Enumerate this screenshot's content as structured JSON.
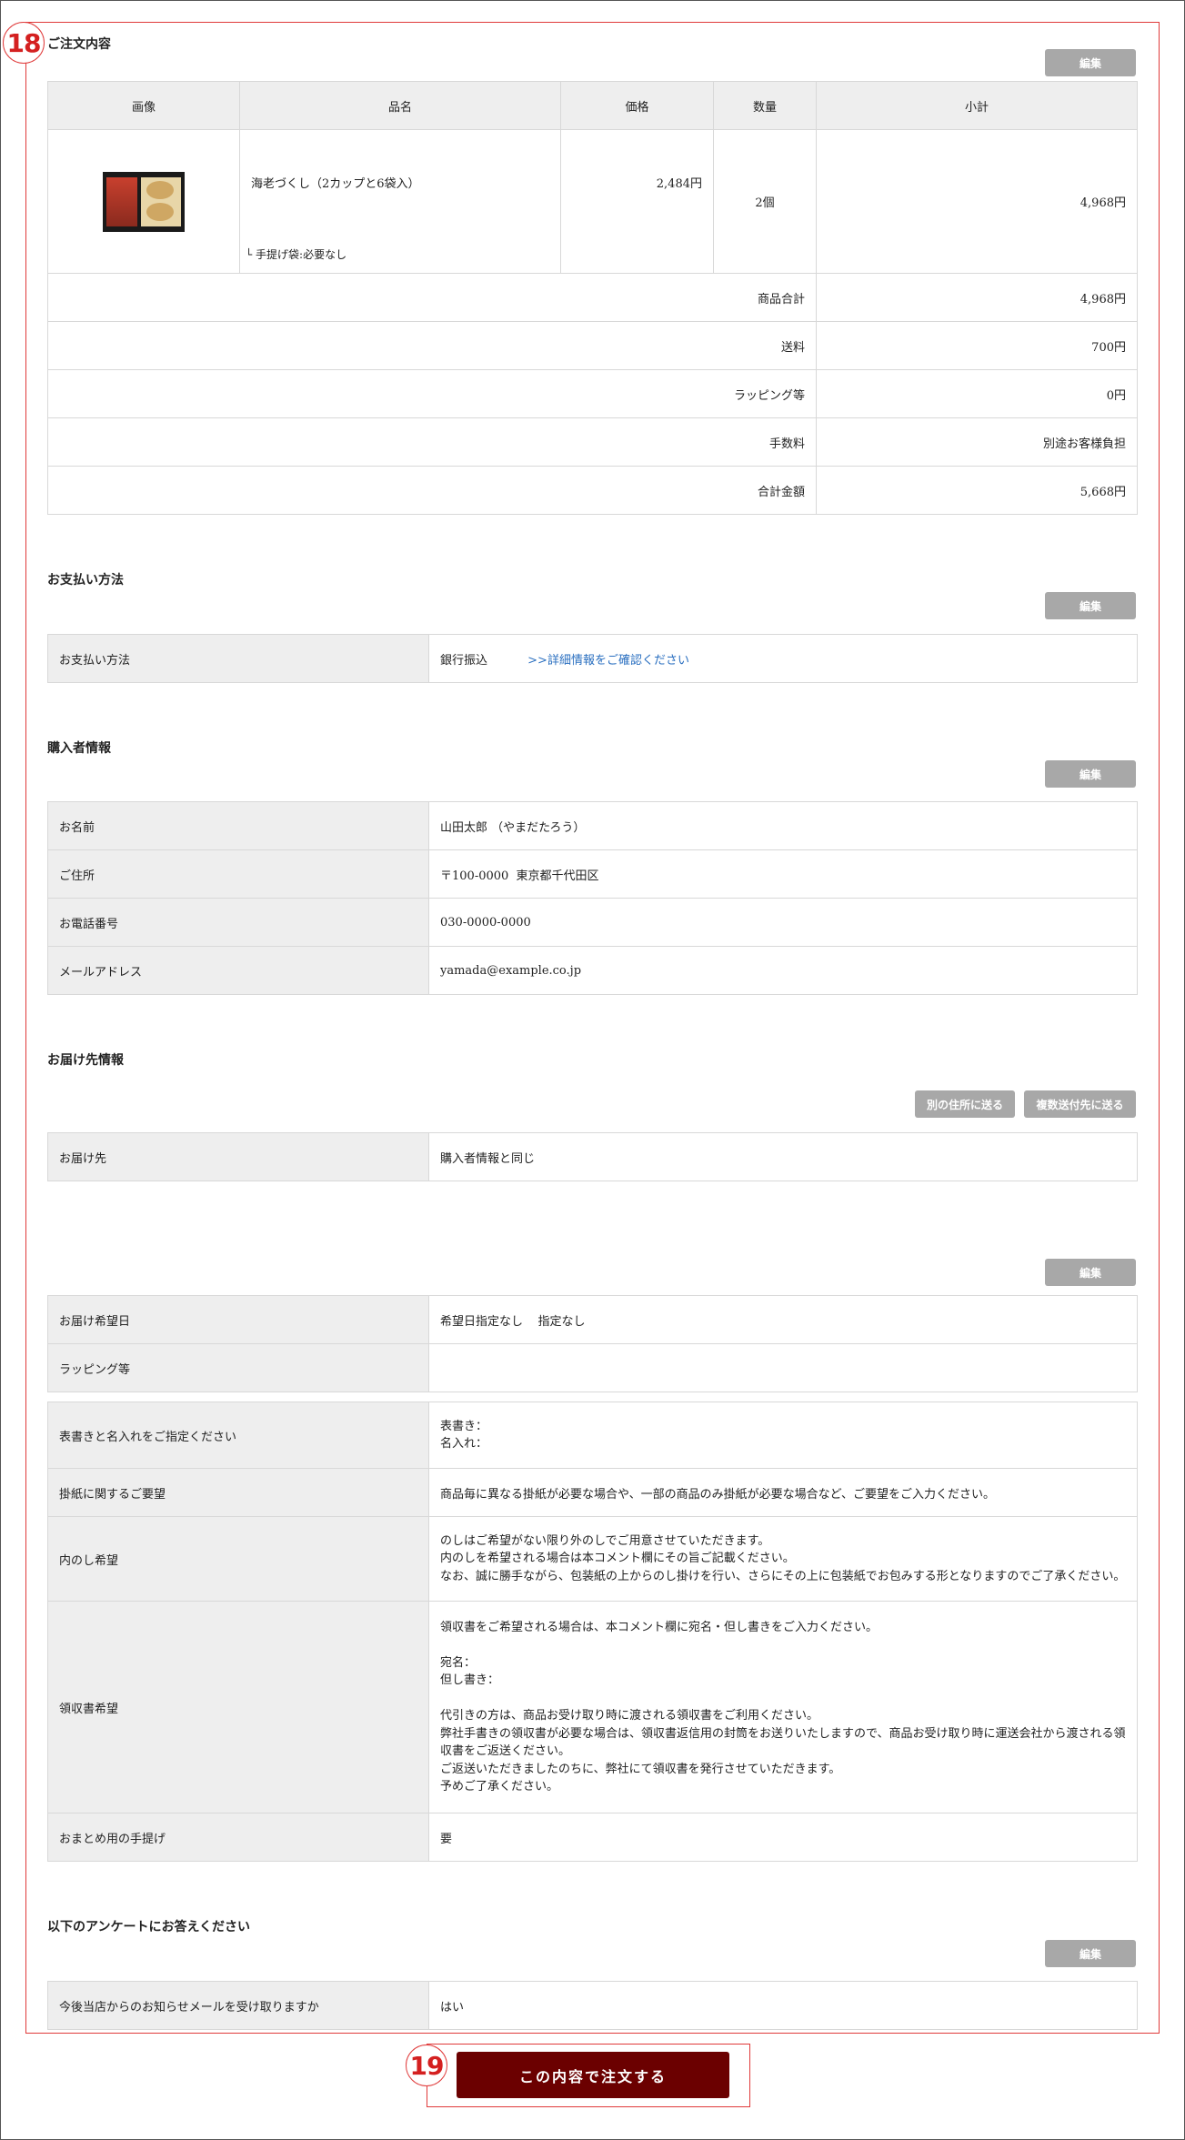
{
  "markers": {
    "section": "18",
    "submit": "19"
  },
  "order": {
    "title": "ご注文内容",
    "edit": "編集",
    "headers": [
      "画像",
      "品名",
      "価格",
      "数量",
      "小計"
    ],
    "item": {
      "image_alt": "商品画像",
      "name": "海老づくし（2カップと6袋入）",
      "option": "└ 手提げ袋:必要なし",
      "price": "2,484円",
      "qty": "2個",
      "subtotal": "4,968円"
    },
    "totals": [
      {
        "label": "商品合計",
        "value": "4,968円"
      },
      {
        "label": "送料",
        "value": "700円"
      },
      {
        "label": "ラッピング等",
        "value": "0円"
      },
      {
        "label": "手数料",
        "value": "別途お客様負担"
      },
      {
        "label": "合計金額",
        "value": "5,668円"
      }
    ]
  },
  "payment": {
    "title": "お支払い方法",
    "edit": "編集",
    "label": "お支払い方法",
    "value": "銀行振込",
    "link": ">>詳細情報をご確認ください"
  },
  "buyer": {
    "title": "購入者情報",
    "edit": "編集",
    "rows": [
      {
        "k": "お名前",
        "v": "山田太郎 （やまだたろう）"
      },
      {
        "k": "ご住所",
        "v": "〒100-0000  東京都千代田区"
      },
      {
        "k": "お電話番号",
        "v": "030-0000-0000"
      },
      {
        "k": "メールアドレス",
        "v": "yamada@example.co.jp"
      }
    ]
  },
  "delivery": {
    "title": "お届け先情報",
    "other_address_btn": "別の住所に送る",
    "multi_address_btn": "複数送付先に送る",
    "label": "お届け先",
    "value": "購入者情報と同じ"
  },
  "options": {
    "edit": "編集",
    "date": {
      "k": "お届け希望日",
      "v": "希望日指定なし    指定なし"
    },
    "wrapping": {
      "k": "ラッピング等",
      "v": ""
    },
    "noshi_name": {
      "k": "表書きと名入れをご指定ください",
      "v1": "表書き：",
      "v2": "名入れ："
    },
    "kakegami": {
      "k": "掛紙に関するご要望",
      "v": "商品毎に異なる掛紙が必要な場合や、一部の商品のみ掛紙が必要な場合など、ご要望をご入力ください。"
    },
    "uchinoshi": {
      "k": "内のし希望",
      "v1": "のしはご希望がない限り外のしでご用意させていただきます。",
      "v2": "内のしを希望される場合は本コメント欄にその旨ご記載ください。",
      "v3": "なお、誠に勝手ながら、包装紙の上からのし掛けを行い、さらにその上に包装紙でお包みする形となりますのでご了承ください。"
    },
    "receipt": {
      "k": "領収書希望",
      "v1": "領収書をご希望される場合は、本コメント欄に宛名・但し書きをご入力ください。",
      "v2": "宛名：",
      "v3": "但し書き：",
      "v4": "代引きの方は、商品お受け取り時に渡される領収書をご利用ください。",
      "v5": "弊社手書きの領収書が必要な場合は、領収書返信用の封筒をお送りいたしますので、商品お受け取り時に運送会社から渡される領",
      "v6": "収書をご返送ください。",
      "v7": "ご返送いただきましたのちに、弊社にて領収書を発行させていただきます。",
      "v8": "予めご了承ください。"
    },
    "bag": {
      "k": "おまとめ用の手提げ",
      "v": "要"
    }
  },
  "survey": {
    "title": "以下のアンケートにお答えください",
    "edit": "編集",
    "k": "今後当店からのお知らせメールを受け取りますか",
    "v": "はい"
  },
  "submit": {
    "label": "この内容で注文する"
  },
  "colors": {
    "accent_red": "#e03a3a",
    "submit_bg": "#6b0000",
    "header_bg": "#eeeeee",
    "link": "#2a6fc0"
  }
}
